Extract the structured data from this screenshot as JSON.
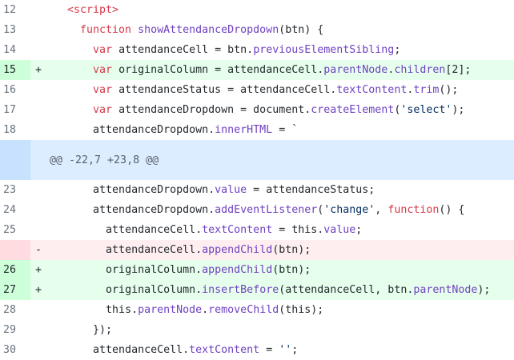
{
  "hunk_header": "@@ -22,7 +23,8 @@",
  "colors": {
    "added_bg": "#e6ffed",
    "added_gutter": "#cdffd8",
    "removed_bg": "#ffeef0",
    "removed_gutter": "#ffdce0",
    "hunk_bg": "#dbedff",
    "hunk_gutter": "#c8e1ff",
    "keyword": "#d73a49",
    "function": "#6f42c1",
    "string": "#032f62"
  },
  "lines": [
    {
      "num": "12",
      "mark": "",
      "type": "ctx",
      "indent": "",
      "tokens": [
        [
          "tag",
          "<script>"
        ]
      ]
    },
    {
      "num": "13",
      "mark": "",
      "type": "ctx",
      "indent": "  ",
      "tokens": [
        [
          "kw",
          "function"
        ],
        [
          "p",
          " "
        ],
        [
          "fn",
          "showAttendanceDropdown"
        ],
        [
          "p",
          "(btn) {"
        ]
      ]
    },
    {
      "num": "14",
      "mark": "",
      "type": "ctx",
      "indent": "    ",
      "tokens": [
        [
          "kw",
          "var"
        ],
        [
          "p",
          " attendanceCell = btn."
        ],
        [
          "fn",
          "previousElementSibling"
        ],
        [
          "p",
          ";"
        ]
      ]
    },
    {
      "num": "15",
      "mark": "+",
      "type": "add",
      "indent": "    ",
      "tokens": [
        [
          "kw",
          "var"
        ],
        [
          "p",
          " originalColumn = attendanceCell."
        ],
        [
          "fn",
          "parentNode"
        ],
        [
          "p",
          "."
        ],
        [
          "fn",
          "children"
        ],
        [
          "p",
          "[2];"
        ]
      ]
    },
    {
      "num": "16",
      "mark": "",
      "type": "ctx",
      "indent": "    ",
      "tokens": [
        [
          "kw",
          "var"
        ],
        [
          "p",
          " attendanceStatus = attendanceCell."
        ],
        [
          "fn",
          "textContent"
        ],
        [
          "p",
          "."
        ],
        [
          "fn",
          "trim"
        ],
        [
          "p",
          "();"
        ]
      ]
    },
    {
      "num": "17",
      "mark": "",
      "type": "ctx",
      "indent": "    ",
      "tokens": [
        [
          "kw",
          "var"
        ],
        [
          "p",
          " attendanceDropdown = document."
        ],
        [
          "fn",
          "createElement"
        ],
        [
          "p",
          "("
        ],
        [
          "str",
          "'select'"
        ],
        [
          "p",
          ");"
        ]
      ]
    },
    {
      "num": "18",
      "mark": "",
      "type": "ctx",
      "indent": "    ",
      "tokens": [
        [
          "p",
          "attendanceDropdown."
        ],
        [
          "fn",
          "innerHTML"
        ],
        [
          "p",
          " = "
        ],
        [
          "str",
          "`"
        ]
      ]
    },
    {
      "num": "",
      "mark": "",
      "type": "hunk",
      "indent": "",
      "tokens": []
    },
    {
      "num": "23",
      "mark": "",
      "type": "ctx",
      "indent": "    ",
      "tokens": [
        [
          "p",
          "attendanceDropdown."
        ],
        [
          "fn",
          "value"
        ],
        [
          "p",
          " = attendanceStatus;"
        ]
      ]
    },
    {
      "num": "24",
      "mark": "",
      "type": "ctx",
      "indent": "    ",
      "tokens": [
        [
          "p",
          "attendanceDropdown."
        ],
        [
          "fn",
          "addEventListener"
        ],
        [
          "p",
          "("
        ],
        [
          "str",
          "'change'"
        ],
        [
          "p",
          ", "
        ],
        [
          "kw",
          "function"
        ],
        [
          "p",
          "() {"
        ]
      ]
    },
    {
      "num": "25",
      "mark": "",
      "type": "ctx",
      "indent": "      ",
      "tokens": [
        [
          "p",
          "attendanceCell."
        ],
        [
          "fn",
          "textContent"
        ],
        [
          "p",
          " = this."
        ],
        [
          "fn",
          "value"
        ],
        [
          "p",
          ";"
        ]
      ]
    },
    {
      "num": "",
      "mark": "-",
      "type": "del",
      "indent": "      ",
      "tokens": [
        [
          "p",
          "attendanceCell."
        ],
        [
          "fn",
          "appendChild"
        ],
        [
          "p",
          "(btn);"
        ]
      ]
    },
    {
      "num": "26",
      "mark": "+",
      "type": "add",
      "indent": "      ",
      "tokens": [
        [
          "p",
          "originalColumn."
        ],
        [
          "fn",
          "appendChild"
        ],
        [
          "p",
          "(btn);"
        ]
      ]
    },
    {
      "num": "27",
      "mark": "+",
      "type": "add",
      "indent": "      ",
      "tokens": [
        [
          "p",
          "originalColumn."
        ],
        [
          "fn",
          "insertBefore"
        ],
        [
          "p",
          "(attendanceCell, btn."
        ],
        [
          "fn",
          "parentNode"
        ],
        [
          "p",
          ");"
        ]
      ]
    },
    {
      "num": "28",
      "mark": "",
      "type": "ctx",
      "indent": "      ",
      "tokens": [
        [
          "p",
          "this."
        ],
        [
          "fn",
          "parentNode"
        ],
        [
          "p",
          "."
        ],
        [
          "fn",
          "removeChild"
        ],
        [
          "p",
          "(this);"
        ]
      ]
    },
    {
      "num": "29",
      "mark": "",
      "type": "ctx",
      "indent": "    ",
      "tokens": [
        [
          "p",
          "});"
        ]
      ]
    },
    {
      "num": "30",
      "mark": "",
      "type": "ctx",
      "indent": "    ",
      "tokens": [
        [
          "p",
          "attendanceCell."
        ],
        [
          "fn",
          "textContent"
        ],
        [
          "p",
          " = "
        ],
        [
          "str",
          "''"
        ],
        [
          "p",
          ";"
        ]
      ]
    }
  ]
}
